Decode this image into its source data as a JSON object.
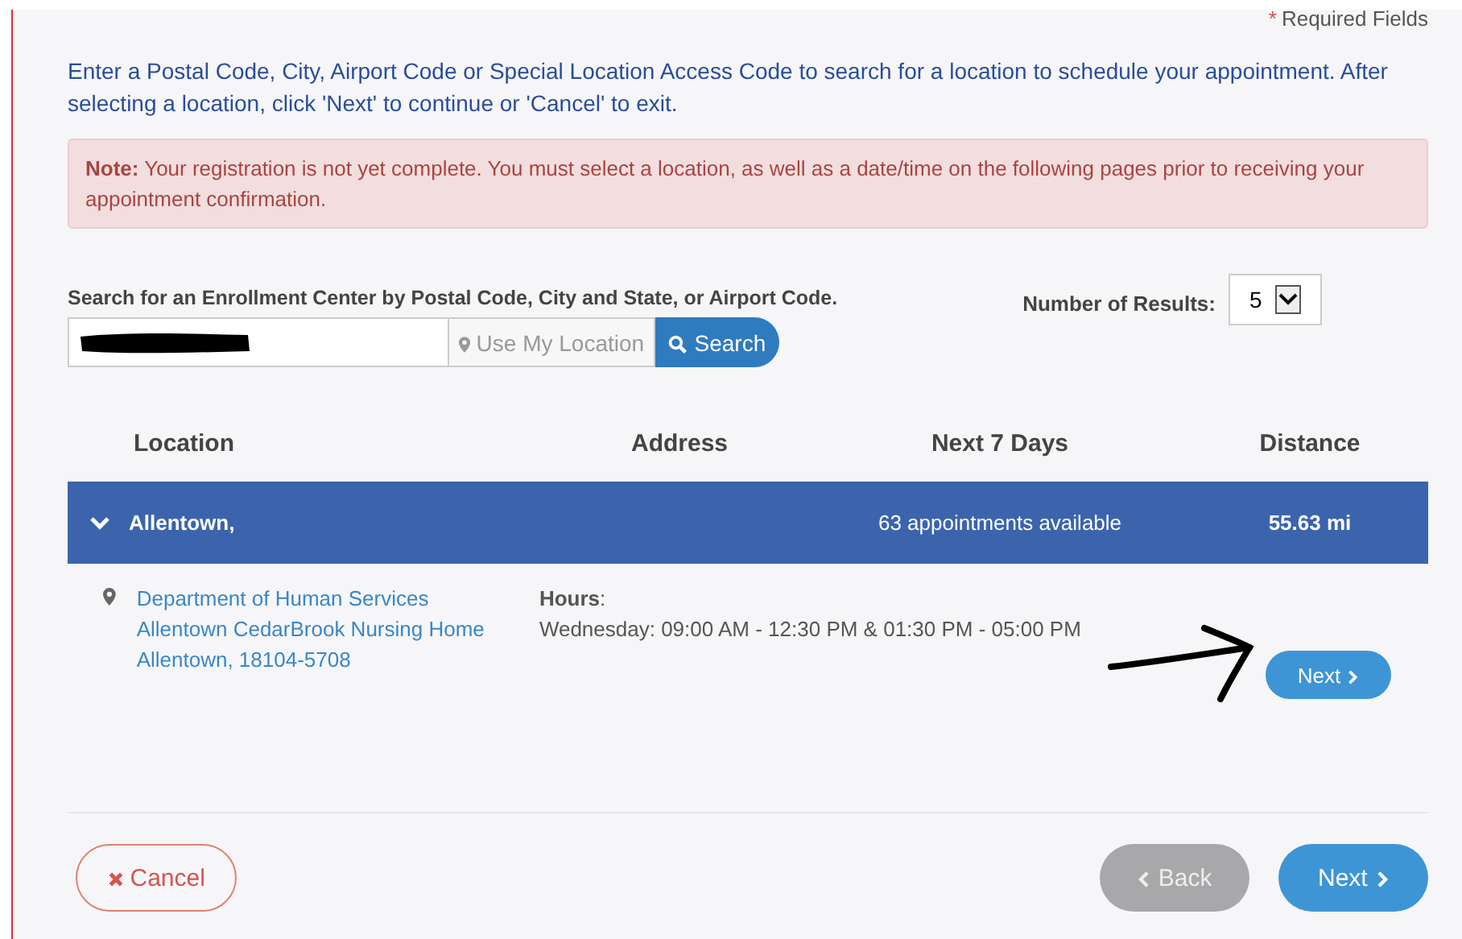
{
  "required_note": {
    "marker": "*",
    "text": "Required Fields"
  },
  "intro": "Enter a Postal Code, City, Airport Code or Special Location Access Code to search for a location to schedule your appointment. After selecting a location, click 'Next' to continue or 'Cancel' to exit.",
  "alert": "**Note:** Your registration is not yet complete. You must select a location, as well as a date/time on the following pages prior to receiving your appointment confirmation.",
  "search": {
    "label": "Search for an Enrollment Center by Postal Code, City and State, or Airport Code.",
    "redacted": true,
    "location_button": "Use My Location",
    "search_button": "Search"
  },
  "results_count": {
    "label": "Number of Results:",
    "value": "5"
  },
  "table": {
    "columns": [
      "Location",
      "Address",
      "Next 7 Days",
      "Distance"
    ],
    "rows": [
      {
        "location": "Allentown,",
        "availability": "63 appointments available",
        "distance": "55.63 mi",
        "expanded": true,
        "details": {
          "address_lines": [
            "Department of Human Services",
            "Allentown CedarBrook Nursing Home",
            "Allentown, 18104-5708"
          ],
          "hours_label": "**Hours**:",
          "hours": "Wednesday: 09:00 AM - 12:30 PM & 01:30 PM - 05:00 PM",
          "button": "Next"
        }
      }
    ]
  },
  "annotation_arrow": true,
  "footer": {
    "cancel": "Cancel",
    "back": {
      "label": "Back",
      "disabled": true
    },
    "next": {
      "label": "Next",
      "disabled": false
    }
  }
}
